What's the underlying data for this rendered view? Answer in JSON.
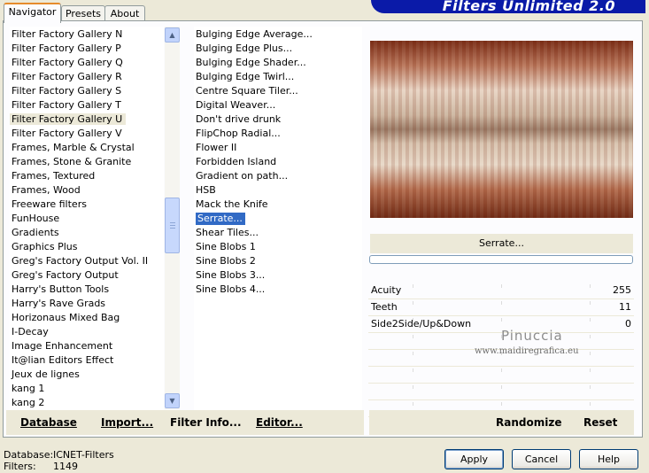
{
  "tabs": [
    "Navigator",
    "Presets",
    "About"
  ],
  "banner_title": "Filters Unlimited 2.0",
  "categories": [
    "Filter Factory Gallery N",
    "Filter Factory Gallery P",
    "Filter Factory Gallery Q",
    "Filter Factory Gallery R",
    "Filter Factory Gallery S",
    "Filter Factory Gallery T",
    "Filter Factory Gallery U",
    "Filter Factory Gallery V",
    "Frames, Marble & Crystal",
    "Frames, Stone & Granite",
    "Frames, Textured",
    "Frames, Wood",
    "Freeware filters",
    "FunHouse",
    "Gradients",
    "Graphics Plus",
    "Greg's Factory Output Vol. II",
    "Greg's Factory Output",
    "Harry's Button Tools",
    "Harry's Rave Grads",
    "Horizonaus Mixed Bag",
    "I-Decay",
    "Image Enhancement",
    "It@lian Editors Effect",
    "Jeux de lignes",
    "kang 1",
    "kang 2"
  ],
  "selected_category": "Filter Factory Gallery U",
  "filters": [
    "Bulging Edge Average...",
    "Bulging Edge Plus...",
    "Bulging Edge Shader...",
    "Bulging Edge Twirl...",
    "Centre Square Tiler...",
    "Digital Weaver...",
    "Don't drive drunk",
    "FlipChop Radial...",
    "Flower II",
    "Forbidden Island",
    "Gradient on path...",
    "HSB",
    "Mack the Knife",
    "Serrate...",
    "Shear Tiles...",
    "Sine Blobs 1",
    "Sine Blobs 2",
    "Sine Blobs 3...",
    "Sine Blobs 4..."
  ],
  "selected_filter": "Serrate...",
  "current_filter_label": "Serrate...",
  "params": [
    {
      "label": "Acuity",
      "value": "255"
    },
    {
      "label": "Teeth",
      "value": "11"
    },
    {
      "label": "Side2Side/Up&Down",
      "value": "0"
    }
  ],
  "watermark": {
    "name": "Pinuccia",
    "site": "www.maidiregrafica.eu"
  },
  "left_buttons": {
    "database": "Database",
    "import": "Import...",
    "filter_info": "Filter Info...",
    "editor": "Editor..."
  },
  "right_buttons": {
    "randomize": "Randomize",
    "reset": "Reset"
  },
  "status": {
    "database_label": "Database:",
    "database_value": "ICNET-Filters",
    "filters_label": "Filters:",
    "filters_value": "1149"
  },
  "dialog_buttons": {
    "apply": "Apply",
    "cancel": "Cancel",
    "help": "Help"
  },
  "icons": {
    "scroll_up": "arrow-up-icon",
    "scroll_down": "arrow-down-icon",
    "grip": "scroll-grip-icon"
  },
  "colors": {
    "selection": "#316ac5",
    "banner": "#0a1aa8",
    "tab_accent": "#e68b2c",
    "face": "#ece9d8"
  }
}
